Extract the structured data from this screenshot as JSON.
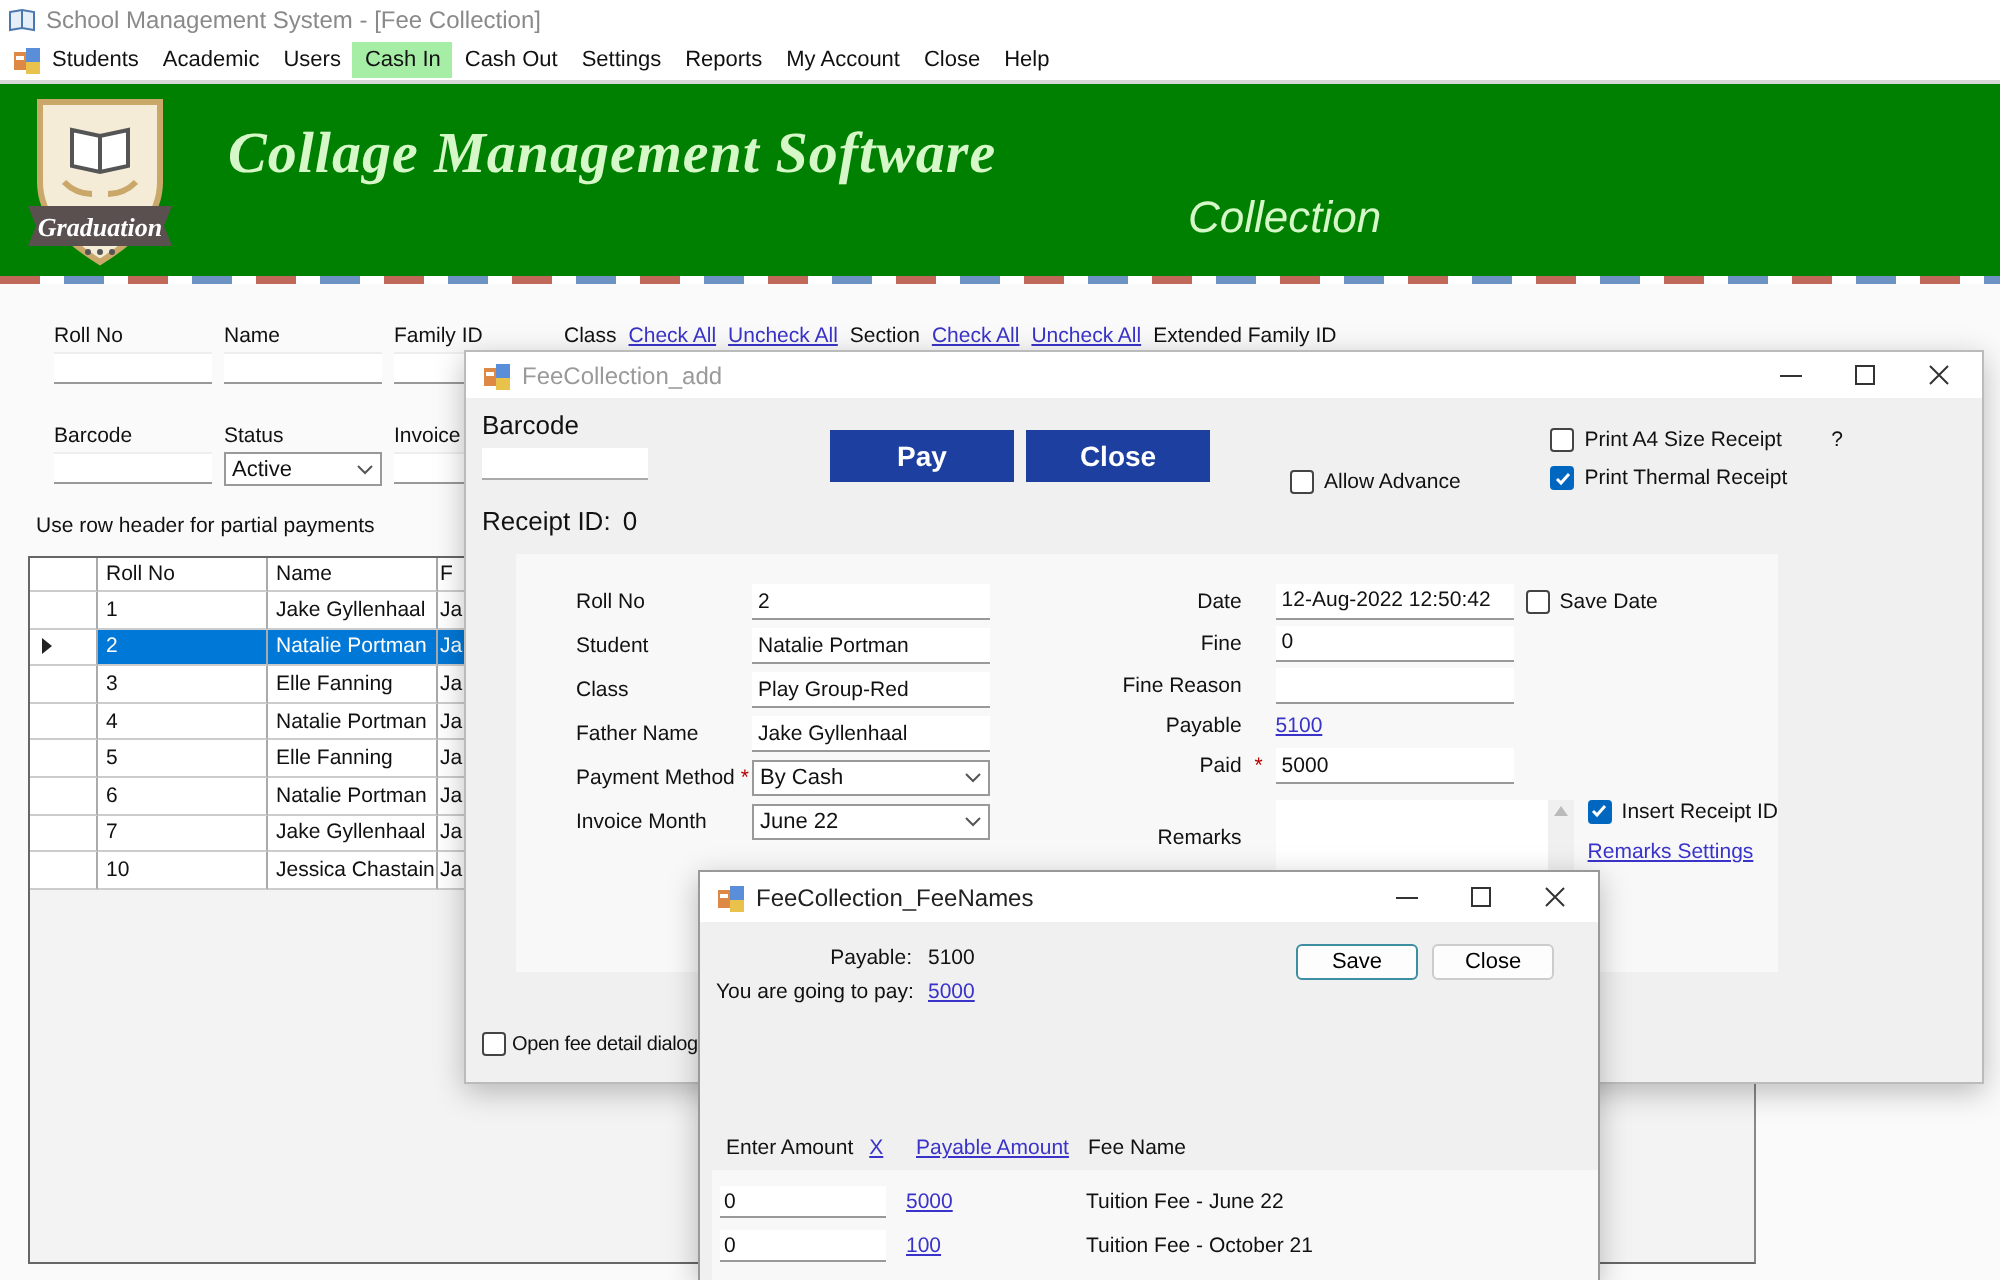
{
  "window": {
    "title": "School Management System - [Fee Collection]"
  },
  "menu": [
    {
      "label": "Students",
      "selected": false
    },
    {
      "label": "Academic",
      "selected": false
    },
    {
      "label": "Users",
      "selected": false
    },
    {
      "label": "Cash In",
      "selected": true
    },
    {
      "label": "Cash Out",
      "selected": false
    },
    {
      "label": "Settings",
      "selected": false
    },
    {
      "label": "Reports",
      "selected": false
    },
    {
      "label": "My Account",
      "selected": false
    },
    {
      "label": "Close",
      "selected": false
    },
    {
      "label": "Help",
      "selected": false
    }
  ],
  "banner": {
    "logo_text": "Graduation",
    "title": "Collage Management Software",
    "subtitle": "Collection"
  },
  "filters": {
    "row_1": [
      {
        "kind": "field",
        "label": "Roll No"
      },
      {
        "kind": "field",
        "label": "Name"
      },
      {
        "kind": "field",
        "label": "Family ID"
      },
      {
        "kind": "label",
        "label": "Class"
      },
      {
        "kind": "link",
        "label": "Check All"
      },
      {
        "kind": "link",
        "label": "Uncheck All"
      },
      {
        "kind": "label",
        "label": "Section"
      },
      {
        "kind": "link",
        "label": "Check All"
      },
      {
        "kind": "link",
        "label": "Uncheck All"
      },
      {
        "kind": "label",
        "label": "Extended Family ID"
      }
    ],
    "row_2": [
      {
        "kind": "field",
        "label": "Barcode"
      },
      {
        "kind": "select",
        "label": "Status",
        "value": "Active"
      },
      {
        "kind": "field",
        "label": "Invoice"
      }
    ]
  },
  "hint": "Use row header for partial payments",
  "table": {
    "columns": [
      "Roll No",
      "Name",
      "F"
    ],
    "rows": [
      {
        "cells": [
          "1",
          "Jake Gyllenhaal",
          "Ja"
        ],
        "selected": false
      },
      {
        "cells": [
          "2",
          "Natalie Portman",
          "Ja"
        ],
        "selected": true
      },
      {
        "cells": [
          "3",
          "Elle Fanning",
          "Ja"
        ],
        "selected": false
      },
      {
        "cells": [
          "4",
          "Natalie Portman",
          "Ja"
        ],
        "selected": false
      },
      {
        "cells": [
          "5",
          "Elle Fanning",
          "Ja"
        ],
        "selected": false
      },
      {
        "cells": [
          "6",
          "Natalie Portman",
          "Ja"
        ],
        "selected": false
      },
      {
        "cells": [
          "7",
          "Jake Gyllenhaal",
          "Ja"
        ],
        "selected": false
      },
      {
        "cells": [
          "10",
          "Jessica Chastain",
          "Ja"
        ],
        "selected": false
      }
    ]
  },
  "fee_dialog": {
    "title": "FeeCollection_add",
    "barcode_label": "Barcode",
    "buttons": [
      {
        "label": "Pay"
      },
      {
        "label": "Close"
      }
    ],
    "allow_advance": {
      "label": "Allow Advance",
      "checked": false
    },
    "print_options": [
      {
        "label": "Print A4 Size Receipt",
        "checked": false
      },
      {
        "label": "Print Thermal Receipt",
        "checked": true
      }
    ],
    "help": "?",
    "receipt_label": "Receipt ID:",
    "receipt_value": "0",
    "left_fields": [
      {
        "kind": "text",
        "label": "Roll No",
        "value": "2"
      },
      {
        "kind": "text",
        "label": "Student",
        "value": "Natalie Portman"
      },
      {
        "kind": "text",
        "label": "Class",
        "value": "Play Group-Red"
      },
      {
        "kind": "text",
        "label": "Father Name",
        "value": "Jake Gyllenhaal"
      },
      {
        "kind": "select",
        "label": "Payment Method",
        "required_mark": "*",
        "value": "By Cash"
      },
      {
        "kind": "select",
        "label": "Invoice Month",
        "value": "June 22"
      }
    ],
    "right_fields": [
      {
        "kind": "text",
        "label": "Date",
        "value": "12-Aug-2022 12:50:42"
      },
      {
        "kind": "text",
        "label": "Fine",
        "value": "0"
      },
      {
        "kind": "text",
        "label": "Fine Reason"
      },
      {
        "kind": "link",
        "label": "Payable",
        "value": "5100"
      },
      {
        "kind": "text",
        "label": "Paid",
        "required_mark": "*",
        "value": "5000"
      },
      {
        "kind": "textarea",
        "label": "Remarks"
      }
    ],
    "save_date": {
      "label": "Save Date",
      "checked": false
    },
    "insert_receipt_id": {
      "label": "Insert Receipt ID",
      "checked": true
    },
    "remarks_settings": "Remarks Settings",
    "open_fee_detail": {
      "label": "Open fee detail dialog",
      "checked": false
    }
  },
  "fee_names_dialog": {
    "title": "FeeCollection_FeeNames",
    "summary": [
      {
        "kind": "text",
        "label": "Payable:",
        "value": "5100"
      },
      {
        "kind": "link",
        "label": "You are going to pay:",
        "value": "5000"
      }
    ],
    "buttons": [
      {
        "label": "Save",
        "focused": true
      },
      {
        "label": "Close",
        "focused": false
      }
    ],
    "columns": [
      {
        "kind": "text",
        "label": "Enter Amount"
      },
      {
        "kind": "link",
        "label": "X"
      },
      {
        "kind": "link",
        "label": "Payable Amount"
      },
      {
        "kind": "text",
        "label": "Fee Name"
      }
    ],
    "rows": [
      {
        "amount": "0",
        "payable": "5000",
        "fee_name": "Tuition Fee - June 22"
      },
      {
        "amount": "0",
        "payable": "100",
        "fee_name": "Tuition Fee - October 21"
      }
    ]
  }
}
